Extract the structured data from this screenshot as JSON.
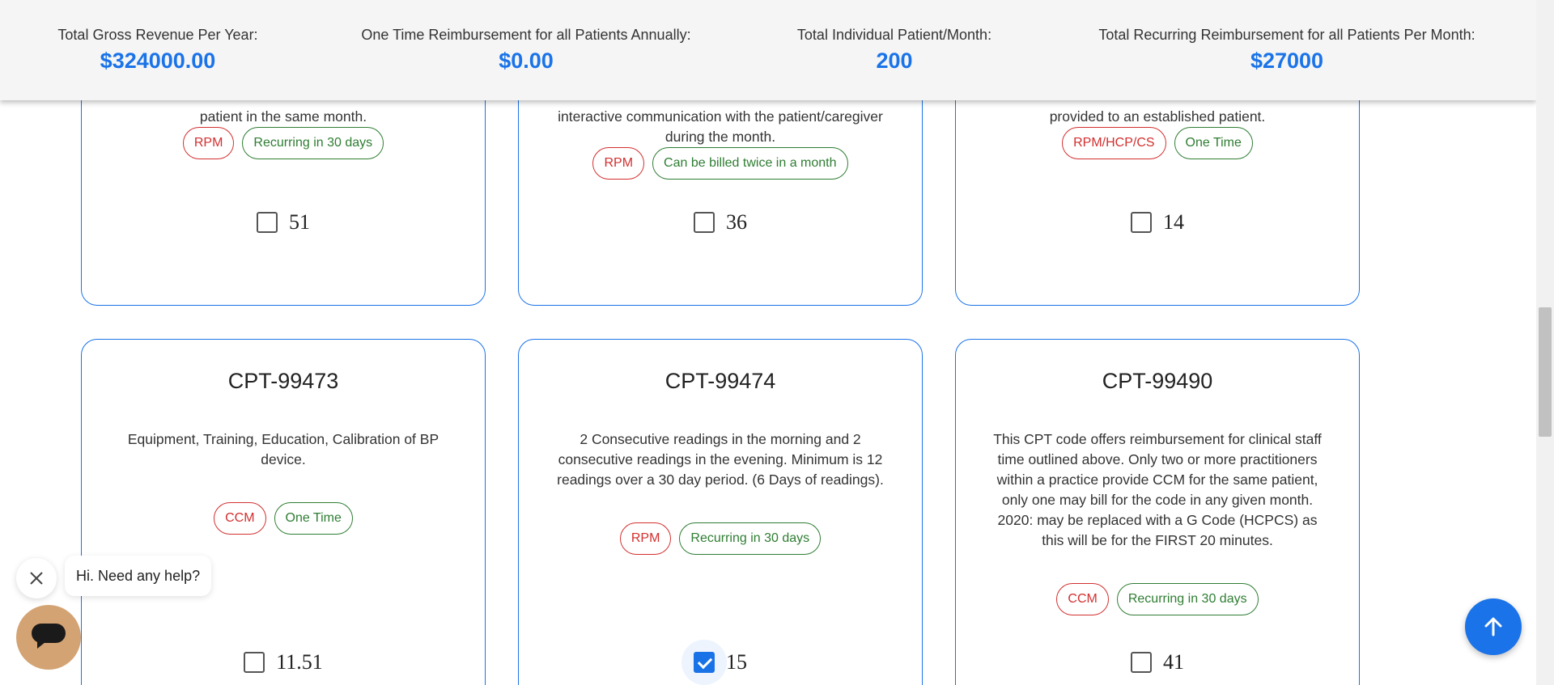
{
  "summary": [
    {
      "label": "Total Gross Revenue Per Year:",
      "value": "$324000.00"
    },
    {
      "label": "One Time Reimbursement for all Patients Annually:",
      "value": "$0.00"
    },
    {
      "label": "Total Individual Patient/Month:",
      "value": "200"
    },
    {
      "label": "Total Recurring Reimbursement for all Patients Per Month:",
      "value": "$27000"
    }
  ],
  "cards_top": [
    {
      "desc_tail": "patient in the same month.",
      "tags": [
        "RPM",
        "Recurring in 30 days"
      ],
      "checked": false,
      "value": "51"
    },
    {
      "desc_tail": "interactive communication with the patient/caregiver during the month.",
      "tags": [
        "RPM",
        "Can be billed twice in a month"
      ],
      "checked": false,
      "value": "36"
    },
    {
      "desc_tail": "provided to an established patient.",
      "tags": [
        "RPM/HCP/CS",
        "One Time"
      ],
      "checked": false,
      "value": "14"
    }
  ],
  "cards_bottom": [
    {
      "title": "CPT-99473",
      "desc": "Equipment, Training, Education, Calibration of BP device.",
      "tags": [
        "CCM",
        "One Time"
      ],
      "checked": false,
      "value": "11.51"
    },
    {
      "title": "CPT-99474",
      "desc": "2 Consecutive readings in the morning and 2 consecutive readings in the evening. Minimum is 12 readings over a 30 day period. (6 Days of readings).",
      "tags": [
        "RPM",
        "Recurring in 30 days"
      ],
      "checked": true,
      "value": "15"
    },
    {
      "title": "CPT-99490",
      "desc": "This CPT code offers reimbursement for clinical staff time outlined above. Only two or more practitioners within a practice provide CCM for the same patient, only one may bill for the code in any given month. 2020: may be replaced with a G Code (HCPCS) as this will be for the FIRST 20 minutes.",
      "tags": [
        "CCM",
        "Recurring in 30 days"
      ],
      "checked": false,
      "value": "41"
    }
  ],
  "chat": {
    "greeting": "Hi. Need any help?",
    "close_icon": "close-icon",
    "launcher_icon": "chat-icon"
  },
  "scroll_top_icon": "arrow-up-icon",
  "colors": {
    "accent": "#1a73e8",
    "tag_red": "#d32f2f",
    "tag_green": "#2e7d32",
    "chat_launcher": "#d4a373"
  }
}
